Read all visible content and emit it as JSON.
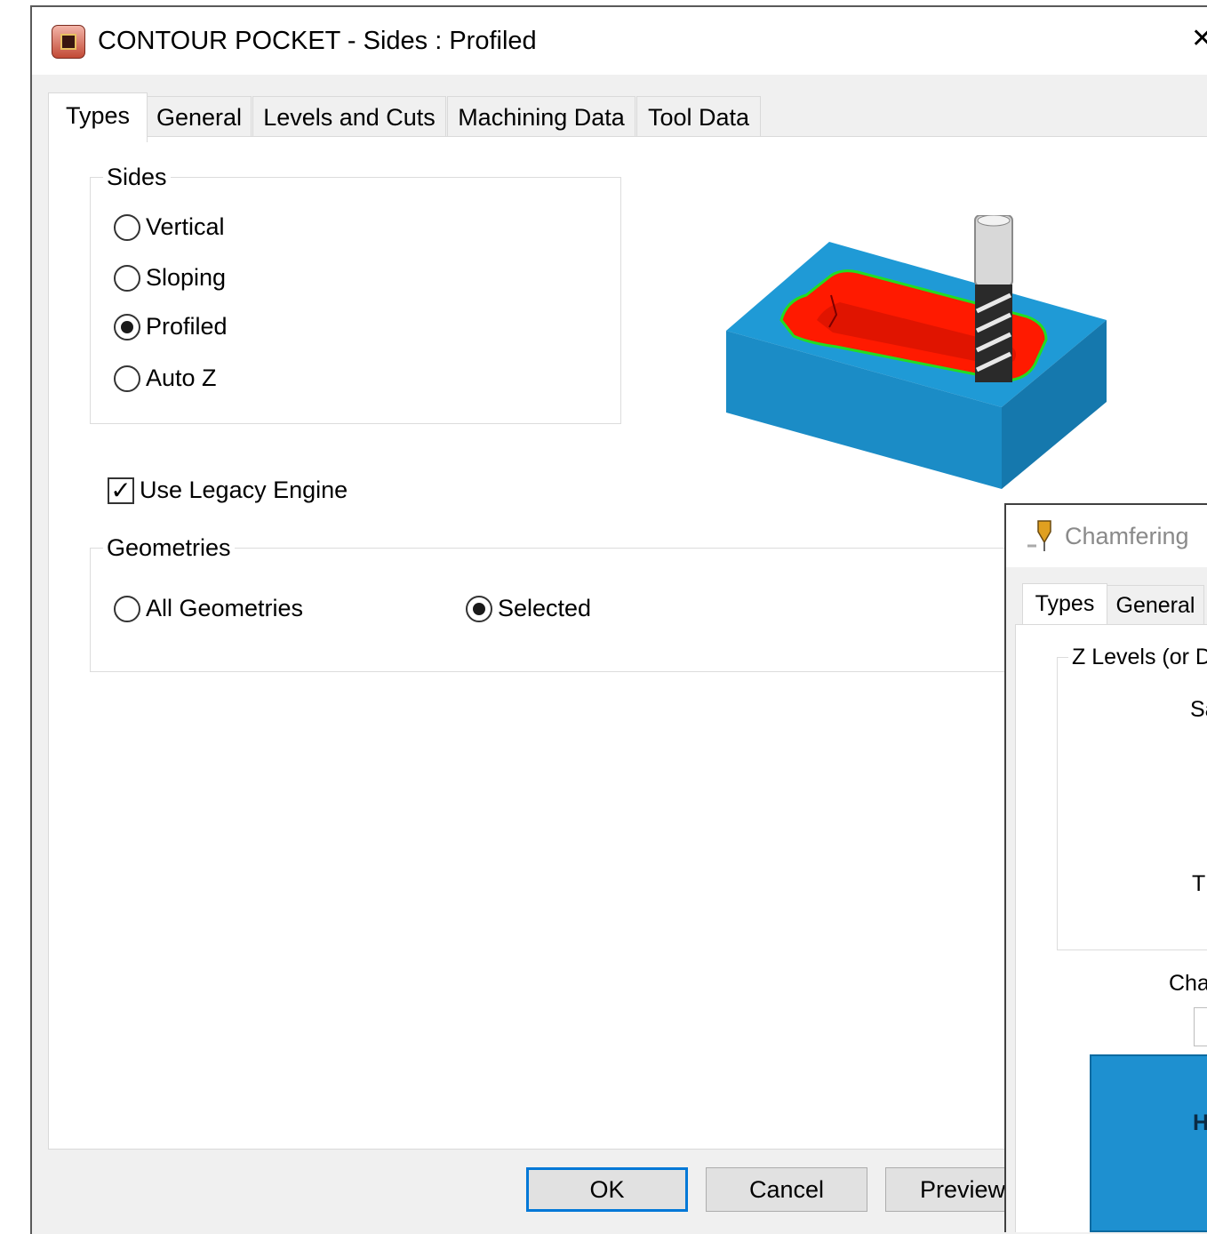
{
  "window": {
    "title": "CONTOUR POCKET - Sides : Profiled",
    "close_glyph": "✕"
  },
  "tabs": [
    {
      "label": "Types",
      "active": true
    },
    {
      "label": "General"
    },
    {
      "label": "Levels and Cuts"
    },
    {
      "label": "Machining Data"
    },
    {
      "label": "Tool Data"
    }
  ],
  "sides": {
    "legend": "Sides",
    "options": [
      {
        "label": "Vertical",
        "selected": false
      },
      {
        "label": "Sloping",
        "selected": false
      },
      {
        "label": "Profiled",
        "selected": true
      },
      {
        "label": "Auto Z",
        "selected": false
      }
    ]
  },
  "legacy": {
    "label": "Use Legacy Engine",
    "checked": true,
    "check_glyph": "✓"
  },
  "geometries": {
    "legend": "Geometries",
    "options": [
      {
        "label": "All Geometries",
        "selected": false
      },
      {
        "label": "Selected",
        "selected": true
      }
    ]
  },
  "buttons": {
    "ok": "OK",
    "cancel": "Cancel",
    "preview": "Preview"
  },
  "chamfer_window": {
    "title": "Chamfering",
    "tabs": [
      "Types",
      "General"
    ],
    "group_legend": "Z Levels (or Di",
    "labels": [
      "Sa",
      "T",
      "Cha",
      "H"
    ]
  },
  "colors": {
    "block": "#1f9ad6",
    "pocket": "#ff1a00",
    "contour": "#22dd22",
    "focus": "#0078d7"
  }
}
